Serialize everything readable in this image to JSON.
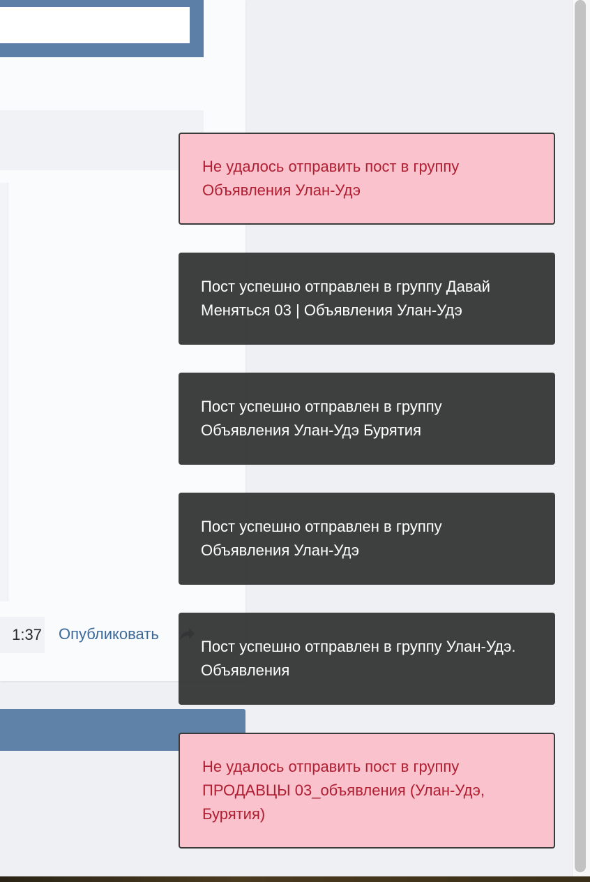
{
  "post": {
    "time": "1:37",
    "publish_label": "Опубликовать"
  },
  "toasts": [
    {
      "type": "error",
      "text": "Не удалось отправить пост в группу Объявления Улан-Удэ"
    },
    {
      "type": "success",
      "text": "Пост успешно отправлен в группу Давай Меняться 03 | Объявления Улан-Удэ"
    },
    {
      "type": "success",
      "text": "Пост успешно отправлен в группу Объявления Улан-Удэ Бурятия"
    },
    {
      "type": "success",
      "text": "Пост успешно отправлен в группу Объявления Улан-Удэ"
    },
    {
      "type": "success",
      "text": "Пост успешно отправлен в группу Улан-Удэ. Объявления"
    },
    {
      "type": "error",
      "text": "Не удалось отправить пост в группу ПРОДАВЦЫ 03_объявления (Улан-Удэ, Бурятия)"
    }
  ],
  "colors": {
    "error_bg": "#f9c2cc",
    "error_text": "#b01e32",
    "success_bg": "#343535",
    "success_text": "#ffffff",
    "accent": "#5b7fa6"
  },
  "icons": {
    "share": "share-arrow-icon"
  }
}
